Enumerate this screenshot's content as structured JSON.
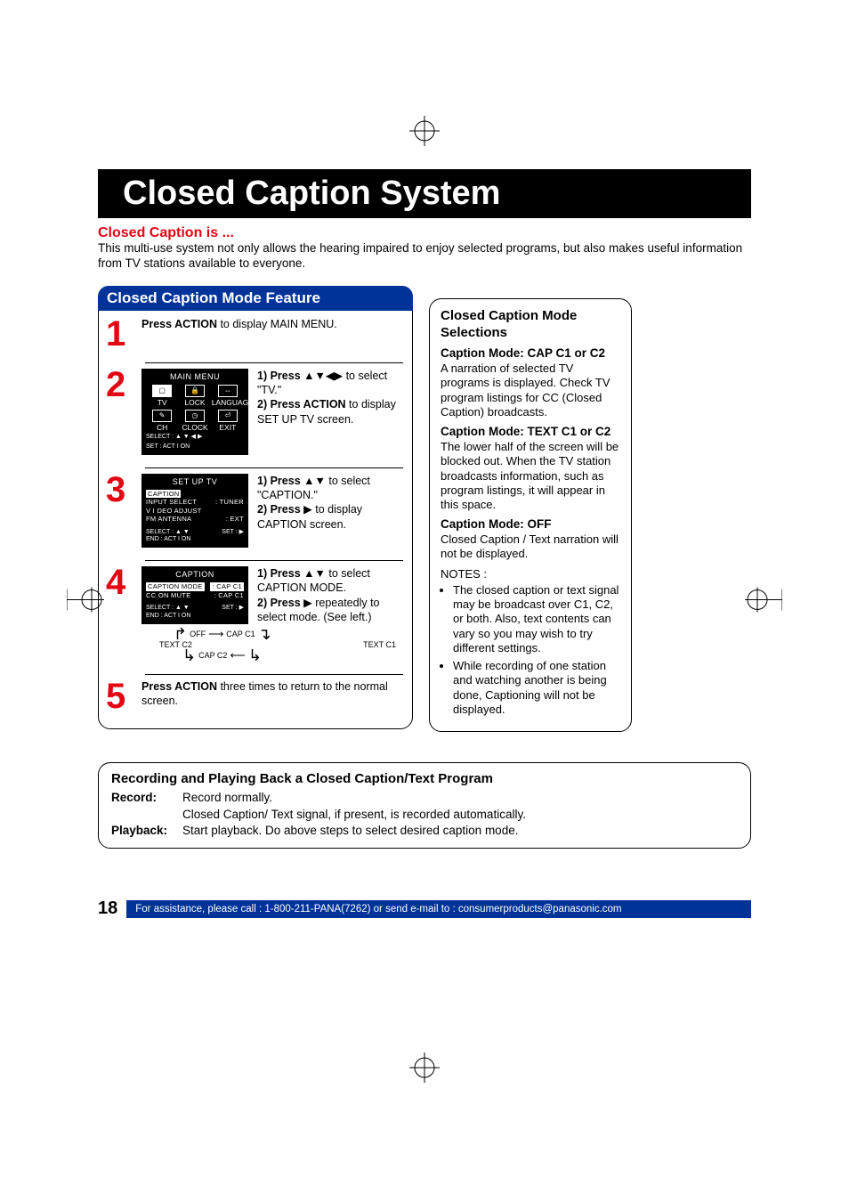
{
  "title": "Closed Caption System",
  "intro_head": "Closed Caption is ...",
  "intro_body": "This multi-use system not only allows the hearing impaired to enjoy selected programs, but also makes useful information from TV stations available to everyone.",
  "feature_title": "Closed Caption Mode Feature",
  "steps": {
    "s1": {
      "num": "1",
      "pre": "Press ACTION",
      "post": " to display MAIN MENU."
    },
    "s2": {
      "num": "2",
      "l1a": "1)  Press ",
      "l1b": " to select \"TV.\"",
      "l2a": "2)  Press ACTION",
      "l2b": " to display SET UP TV screen."
    },
    "s3": {
      "num": "3",
      "l1a": "1)  Press ",
      "l1b": " to select \"CAPTION.\"",
      "l2a": "2)  Press ",
      "l2b": " to display CAPTION screen."
    },
    "s4": {
      "num": "4",
      "l1a": "1)  Press ",
      "l1b": " to select CAPTION MODE.",
      "l2a": "2)  Press ",
      "l2b": " repeatedly to select mode. (See left.)"
    },
    "s5": {
      "num": "5",
      "pre": "Press ACTION",
      "post": " three times to return to the normal screen."
    }
  },
  "osd": {
    "main_title": "MAIN  MENU",
    "cells": [
      "TV",
      "LOCK",
      "LANGUAGE",
      "CH",
      "CLOCK",
      "EXIT"
    ],
    "select": "SELECT : ▲ ▼ ◀ ▶",
    "set": "SET       : ACT I ON",
    "setup_title": "SET  UP  TV",
    "setup_rows": [
      {
        "l": "CAPTION",
        "r": "",
        "hl": true
      },
      {
        "l": "INPUT  SELECT",
        "r": ": TUNER"
      },
      {
        "l": "V I DEO  ADJUST",
        "r": ""
      },
      {
        "l": "FM  ANTENNA",
        "r": ": EXT"
      }
    ],
    "foot_sel": "SELECT : ▲ ▼",
    "foot_set": "SET : ▶",
    "foot_end": "END      : ACT I ON",
    "cap_title": "CAPTION",
    "cap_rows": [
      {
        "l": "CAPTION MODE",
        "r": ":  CAP  C1",
        "hl": true
      },
      {
        "l": "CC  ON  MUTE",
        "r": ":  CAP  C1"
      }
    ]
  },
  "cycle": {
    "off": "OFF",
    "c1": "CAP  C1",
    "tc2": "TEXT  C2",
    "tc1": "TEXT  C1",
    "c2": "CAP  C2"
  },
  "right": {
    "head": "Closed Caption Mode Selections",
    "m1h": "Caption Mode: CAP C1 or C2",
    "m1b": "A narration of selected TV programs is displayed. Check TV program listings for CC (Closed Caption) broadcasts.",
    "m2h": "Caption Mode: TEXT C1 or C2",
    "m2b": "The lower half of the screen will be blocked out. When the TV station broadcasts information, such as program listings, it will appear in this space.",
    "m3h": "Caption Mode: OFF",
    "m3b": "Closed Caption / Text narration will not be displayed.",
    "notes": "NOTES :",
    "n1": "The closed caption or text signal may be broadcast over C1, C2, or both. Also, text contents can vary so you may wish to try different settings.",
    "n2": "While recording of one station and watching another is being done, Captioning will not be displayed."
  },
  "bottom": {
    "head": "Recording and Playing Back a Closed Caption/Text Program",
    "rec_lab": "Record:",
    "rec1": "Record normally.",
    "rec2": "Closed Caption/ Text signal, if present, is recorded automatically.",
    "pb_lab": "Playback:",
    "pb": "Start playback. Do above steps to select desired caption mode."
  },
  "page_num": "18",
  "assist": "For assistance, please call : 1-800-211-PANA(7262) or send e-mail to : consumerproducts@panasonic.com"
}
